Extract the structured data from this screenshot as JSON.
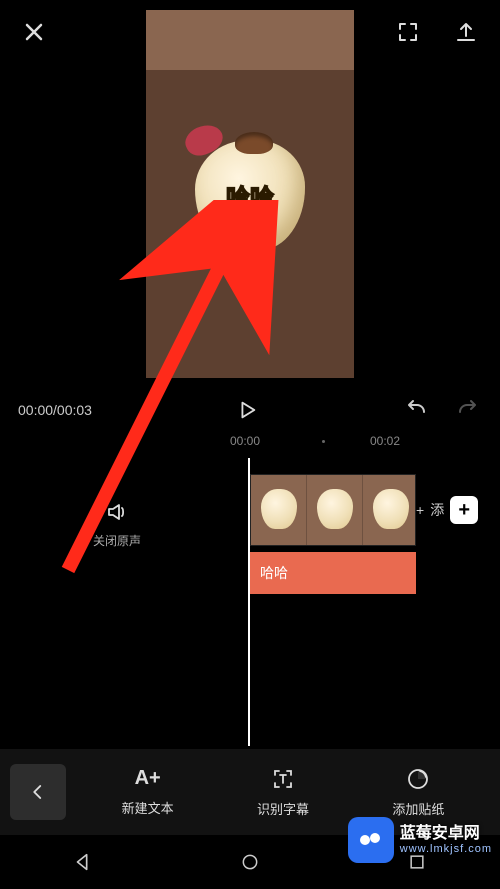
{
  "preview": {
    "caption": "哈哈"
  },
  "playback": {
    "current": "00:00",
    "total": "00:03",
    "display": "00:00/00:03"
  },
  "ruler": {
    "marks": [
      "00:00",
      "00:02"
    ]
  },
  "timeline": {
    "audio_toggle_label": "关闭原声",
    "text_clip_label": "哈哈",
    "add_label_prefix": "+",
    "add_label_text": "添"
  },
  "tools": {
    "new_text": "新建文本",
    "recognize": "识别字幕",
    "sticker": "添加贴纸"
  },
  "icons": {
    "new_text_icon_label": "A+"
  },
  "watermark": {
    "line1": "蓝莓安卓网",
    "line2": "www.lmkjsf.com"
  }
}
